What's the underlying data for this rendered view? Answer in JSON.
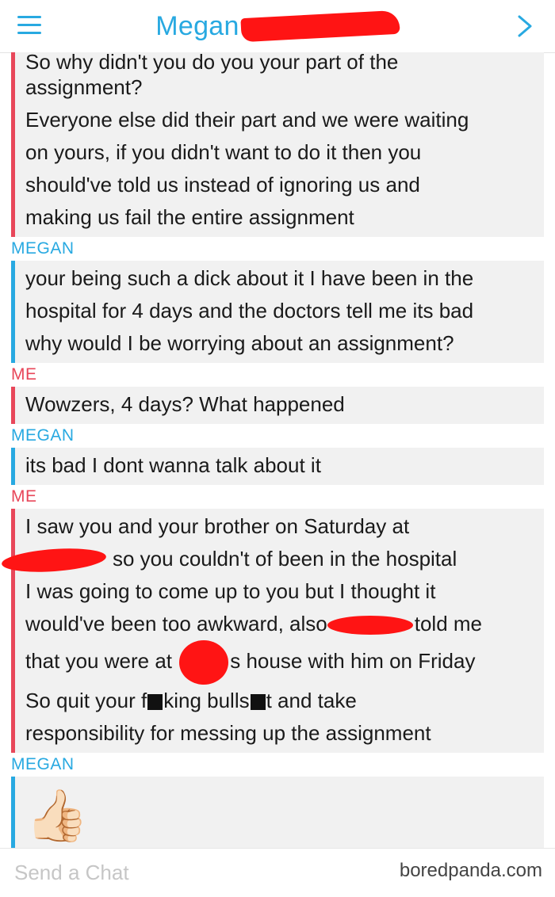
{
  "header": {
    "title": "Megan",
    "menu_icon": "hamburger-menu-icon",
    "next_icon": "chevron-right-icon",
    "accent": "#28a9e1"
  },
  "colors": {
    "megan": "#28a9e1",
    "me": "#e8475a",
    "bubble": "#f1f1f1",
    "redaction": "#ff1414"
  },
  "messages": [
    {
      "sender": "",
      "lines": [
        "So why didn't you do you your part of the",
        "assignment?",
        "Everyone else did their part and we were waiting",
        "on yours, if you didn't want to do it then you",
        "should've told us instead of ignoring us and",
        "making us fail the entire assignment"
      ]
    },
    {
      "sender": "MEGAN",
      "lines": [
        "your being such a dick about it I have been in the",
        "hospital for 4 days and the doctors tell me its bad",
        "why would I be worrying about an assignment?"
      ]
    },
    {
      "sender": "ME",
      "lines": [
        "Wowzers, 4 days? What happened"
      ]
    },
    {
      "sender": "MEGAN",
      "lines": [
        "its bad I dont wanna talk about it"
      ]
    },
    {
      "sender": "ME",
      "lines": [
        "I saw you and your brother on Saturday at",
        "so you couldn't of been in the hospital",
        "I was going to come up to you but I thought it",
        "would've been too awkward, also",
        "told me",
        "that you were at",
        "s house with him on Friday",
        "So quit your f",
        "king bulls",
        "t and take",
        "responsibility for messing up the assignment"
      ]
    },
    {
      "sender": "MEGAN",
      "emoji": "👍🏻"
    }
  ],
  "footer": {
    "placeholder": "Send a Chat",
    "watermark": "boredpanda.com"
  }
}
